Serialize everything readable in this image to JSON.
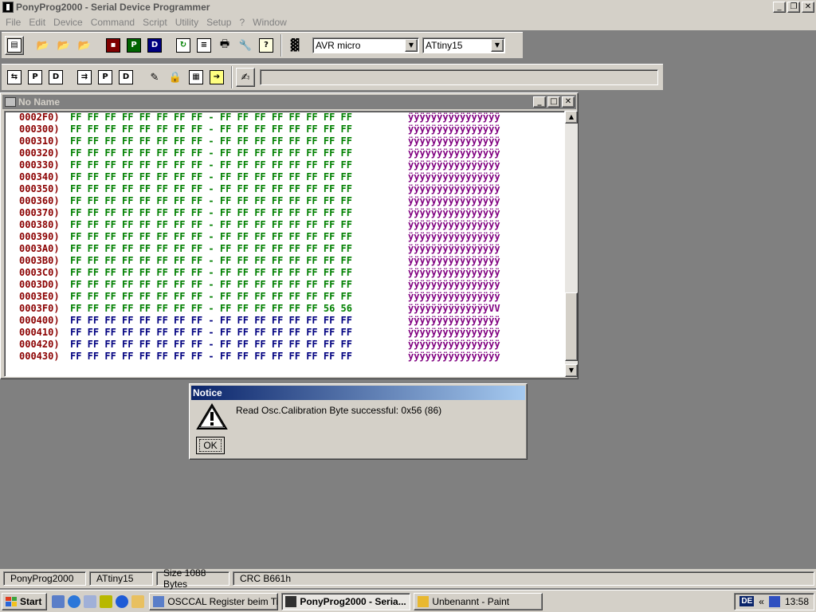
{
  "window": {
    "title": "PonyProg2000 - Serial Device Programmer",
    "caption_buttons": [
      "_",
      "❐",
      "✕"
    ]
  },
  "menu": [
    "File",
    "Edit",
    "Device",
    "Command",
    "Script",
    "Utility",
    "Setup",
    "?",
    "Window"
  ],
  "toolbar1": {
    "device_family": "AVR micro",
    "device_type": "ATtiny15",
    "buttons": [
      "open-window",
      "open-file",
      "open-program",
      "open-data",
      "save",
      "save-program",
      "save-data",
      "reload",
      "edit-buffer",
      "print",
      "setup",
      "help"
    ]
  },
  "toolbar2": {
    "buttons": [
      "read-all",
      "read-program",
      "read-data",
      "write-all",
      "write-program",
      "write-data",
      "erase",
      "security-bits",
      "config-bits",
      "next"
    ],
    "script_value": ""
  },
  "editor": {
    "title": "No Name",
    "rows": [
      {
        "addr": "0002F0)",
        "bytes": "FF FF FF FF FF FF FF FF - FF FF FF FF FF FF FF FF",
        "ascii": "ÿÿÿÿÿÿÿÿÿÿÿÿÿÿÿÿ",
        "color": "#008000"
      },
      {
        "addr": "000300)",
        "bytes": "FF FF FF FF FF FF FF FF - FF FF FF FF FF FF FF FF",
        "ascii": "ÿÿÿÿÿÿÿÿÿÿÿÿÿÿÿÿ",
        "color": "#008000"
      },
      {
        "addr": "000310)",
        "bytes": "FF FF FF FF FF FF FF FF - FF FF FF FF FF FF FF FF",
        "ascii": "ÿÿÿÿÿÿÿÿÿÿÿÿÿÿÿÿ",
        "color": "#008000"
      },
      {
        "addr": "000320)",
        "bytes": "FF FF FF FF FF FF FF FF - FF FF FF FF FF FF FF FF",
        "ascii": "ÿÿÿÿÿÿÿÿÿÿÿÿÿÿÿÿ",
        "color": "#008000"
      },
      {
        "addr": "000330)",
        "bytes": "FF FF FF FF FF FF FF FF - FF FF FF FF FF FF FF FF",
        "ascii": "ÿÿÿÿÿÿÿÿÿÿÿÿÿÿÿÿ",
        "color": "#008000"
      },
      {
        "addr": "000340)",
        "bytes": "FF FF FF FF FF FF FF FF - FF FF FF FF FF FF FF FF",
        "ascii": "ÿÿÿÿÿÿÿÿÿÿÿÿÿÿÿÿ",
        "color": "#008000"
      },
      {
        "addr": "000350)",
        "bytes": "FF FF FF FF FF FF FF FF - FF FF FF FF FF FF FF FF",
        "ascii": "ÿÿÿÿÿÿÿÿÿÿÿÿÿÿÿÿ",
        "color": "#008000"
      },
      {
        "addr": "000360)",
        "bytes": "FF FF FF FF FF FF FF FF - FF FF FF FF FF FF FF FF",
        "ascii": "ÿÿÿÿÿÿÿÿÿÿÿÿÿÿÿÿ",
        "color": "#008000"
      },
      {
        "addr": "000370)",
        "bytes": "FF FF FF FF FF FF FF FF - FF FF FF FF FF FF FF FF",
        "ascii": "ÿÿÿÿÿÿÿÿÿÿÿÿÿÿÿÿ",
        "color": "#008000"
      },
      {
        "addr": "000380)",
        "bytes": "FF FF FF FF FF FF FF FF - FF FF FF FF FF FF FF FF",
        "ascii": "ÿÿÿÿÿÿÿÿÿÿÿÿÿÿÿÿ",
        "color": "#008000"
      },
      {
        "addr": "000390)",
        "bytes": "FF FF FF FF FF FF FF FF - FF FF FF FF FF FF FF FF",
        "ascii": "ÿÿÿÿÿÿÿÿÿÿÿÿÿÿÿÿ",
        "color": "#008000"
      },
      {
        "addr": "0003A0)",
        "bytes": "FF FF FF FF FF FF FF FF - FF FF FF FF FF FF FF FF",
        "ascii": "ÿÿÿÿÿÿÿÿÿÿÿÿÿÿÿÿ",
        "color": "#008000"
      },
      {
        "addr": "0003B0)",
        "bytes": "FF FF FF FF FF FF FF FF - FF FF FF FF FF FF FF FF",
        "ascii": "ÿÿÿÿÿÿÿÿÿÿÿÿÿÿÿÿ",
        "color": "#008000"
      },
      {
        "addr": "0003C0)",
        "bytes": "FF FF FF FF FF FF FF FF - FF FF FF FF FF FF FF FF",
        "ascii": "ÿÿÿÿÿÿÿÿÿÿÿÿÿÿÿÿ",
        "color": "#008000"
      },
      {
        "addr": "0003D0)",
        "bytes": "FF FF FF FF FF FF FF FF - FF FF FF FF FF FF FF FF",
        "ascii": "ÿÿÿÿÿÿÿÿÿÿÿÿÿÿÿÿ",
        "color": "#008000"
      },
      {
        "addr": "0003E0)",
        "bytes": "FF FF FF FF FF FF FF FF - FF FF FF FF FF FF FF FF",
        "ascii": "ÿÿÿÿÿÿÿÿÿÿÿÿÿÿÿÿ",
        "color": "#008000"
      },
      {
        "addr": "0003F0)",
        "bytes": "FF FF FF FF FF FF FF FF - FF FF FF FF FF FF 56 56",
        "ascii": "ÿÿÿÿÿÿÿÿÿÿÿÿÿÿVV",
        "color": "#008000"
      },
      {
        "addr": "000400)",
        "bytes": "FF FF FF FF FF FF FF FF - FF FF FF FF FF FF FF FF",
        "ascii": "ÿÿÿÿÿÿÿÿÿÿÿÿÿÿÿÿ",
        "color": "#000080"
      },
      {
        "addr": "000410)",
        "bytes": "FF FF FF FF FF FF FF FF - FF FF FF FF FF FF FF FF",
        "ascii": "ÿÿÿÿÿÿÿÿÿÿÿÿÿÿÿÿ",
        "color": "#000080"
      },
      {
        "addr": "000420)",
        "bytes": "FF FF FF FF FF FF FF FF - FF FF FF FF FF FF FF FF",
        "ascii": "ÿÿÿÿÿÿÿÿÿÿÿÿÿÿÿÿ",
        "color": "#000080"
      },
      {
        "addr": "000430)",
        "bytes": "FF FF FF FF FF FF FF FF - FF FF FF FF FF FF FF FF",
        "ascii": "ÿÿÿÿÿÿÿÿÿÿÿÿÿÿÿÿ",
        "color": "#000080"
      }
    ]
  },
  "dialog": {
    "title": "Notice",
    "message": "Read Osc.Calibration Byte successful: 0x56 (86)",
    "ok_label": "OK"
  },
  "statusbar": {
    "app": "PonyProg2000",
    "device": "ATtiny15",
    "size": "Size  1088 Bytes",
    "crc": "CRC  B661h"
  },
  "taskbar": {
    "start_label": "Start",
    "tasks": [
      {
        "label": "OSCCAL Register beim Ti...",
        "active": false,
        "icon": "browser-icon"
      },
      {
        "label": "PonyProg2000 - Seria...",
        "active": true,
        "icon": "ponyprog-icon"
      },
      {
        "label": "Unbenannt - Paint",
        "active": false,
        "icon": "paint-icon"
      }
    ],
    "language": "DE",
    "clock": "13:58"
  }
}
